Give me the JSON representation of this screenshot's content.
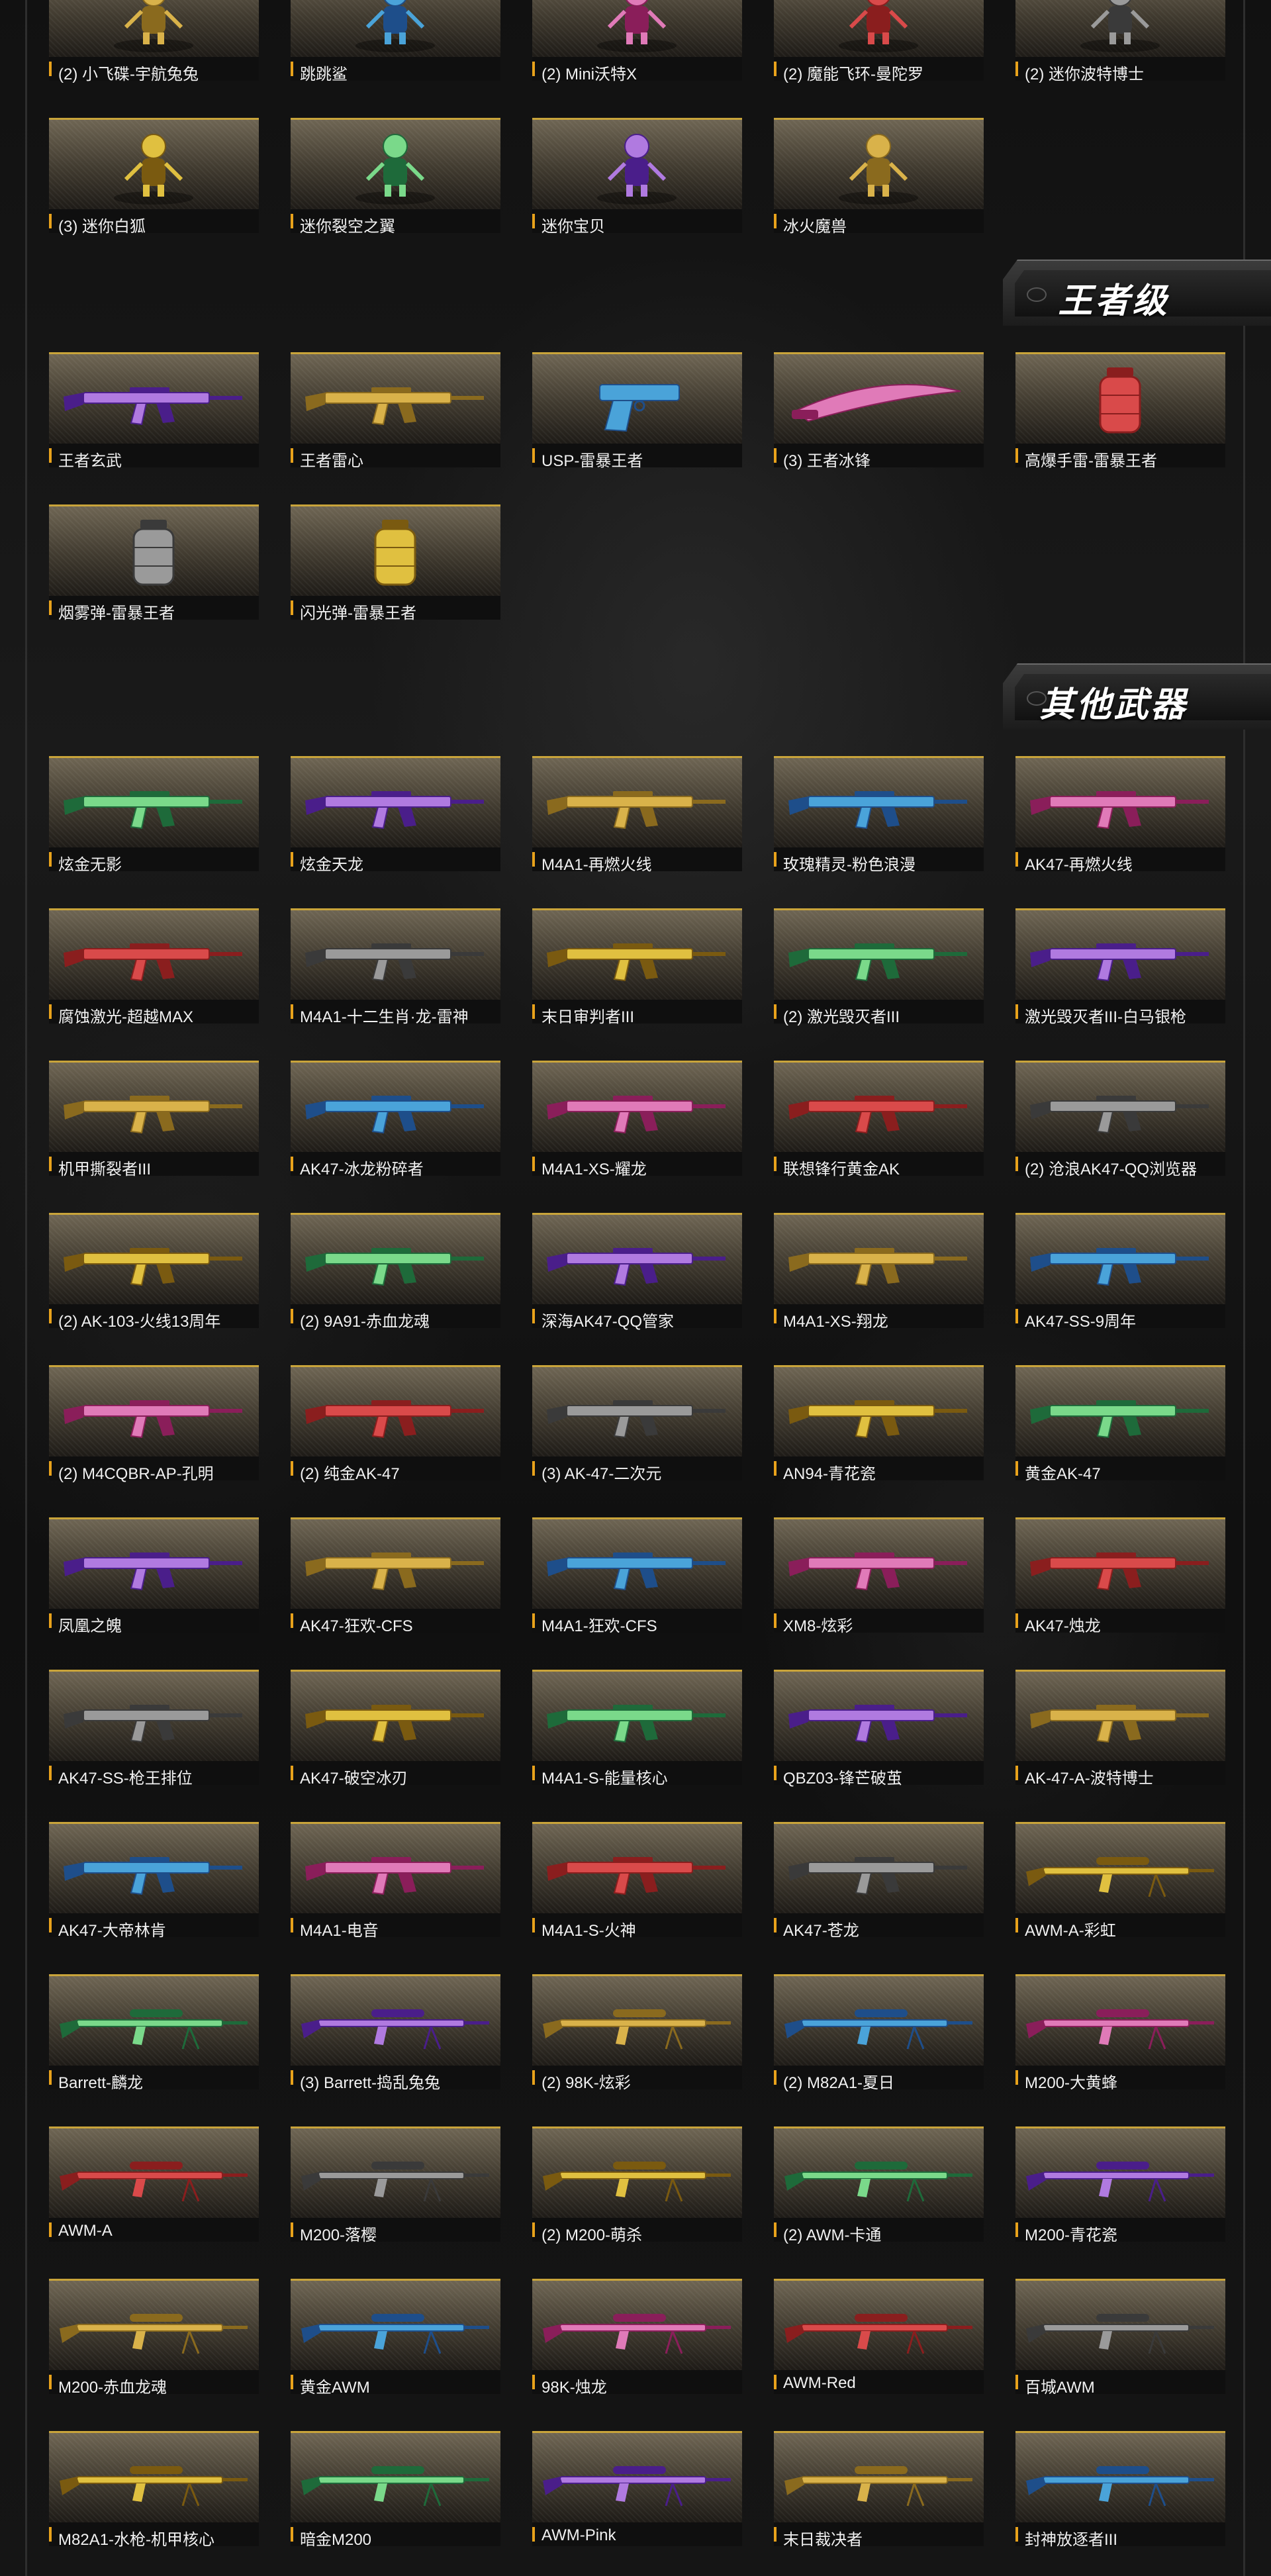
{
  "sections": [
    {
      "title": "",
      "items": [
        {
          "name": "(2) 小飞碟-宇航兔兔",
          "kind": "character"
        },
        {
          "name": "跳跳鲨",
          "kind": "character"
        },
        {
          "name": "(2) Mini沃特X",
          "kind": "character"
        },
        {
          "name": "(2) 魔能飞环-曼陀罗",
          "kind": "character"
        },
        {
          "name": "(2) 迷你波特博士",
          "kind": "character"
        },
        {
          "name": "(3) 迷你白狐",
          "kind": "character"
        },
        {
          "name": "迷你裂空之翼",
          "kind": "character"
        },
        {
          "name": "迷你宝贝",
          "kind": "character"
        },
        {
          "name": "冰火魔兽",
          "kind": "character"
        }
      ]
    },
    {
      "title": "王者级",
      "items": [
        {
          "name": "王者玄武",
          "kind": "rifle"
        },
        {
          "name": "王者雷心",
          "kind": "rifle"
        },
        {
          "name": "USP-雷暴王者",
          "kind": "pistol"
        },
        {
          "name": "(3) 王者冰锋",
          "kind": "blade"
        },
        {
          "name": "高爆手雷-雷暴王者",
          "kind": "grenade"
        },
        {
          "name": "烟雾弹-雷暴王者",
          "kind": "grenade"
        },
        {
          "name": "闪光弹-雷暴王者",
          "kind": "grenade"
        }
      ]
    },
    {
      "title": "其他武器",
      "items": [
        {
          "name": "炫金无影",
          "kind": "rifle"
        },
        {
          "name": "炫金天龙",
          "kind": "rifle"
        },
        {
          "name": "M4A1-再燃火线",
          "kind": "rifle"
        },
        {
          "name": "玫瑰精灵-粉色浪漫",
          "kind": "rifle"
        },
        {
          "name": "AK47-再燃火线",
          "kind": "rifle"
        },
        {
          "name": "腐蚀激光-超越MAX",
          "kind": "rifle"
        },
        {
          "name": "M4A1-十二生肖·龙-雷神",
          "kind": "rifle"
        },
        {
          "name": "末日审判者III",
          "kind": "rifle"
        },
        {
          "name": "(2) 激光毁灭者III",
          "kind": "rifle"
        },
        {
          "name": "激光毁灭者III-白马银枪",
          "kind": "rifle"
        },
        {
          "name": "机甲撕裂者III",
          "kind": "rifle"
        },
        {
          "name": "AK47-冰龙粉碎者",
          "kind": "rifle"
        },
        {
          "name": "M4A1-XS-耀龙",
          "kind": "rifle"
        },
        {
          "name": "联想锋行黄金AK",
          "kind": "rifle"
        },
        {
          "name": "(2) 沧浪AK47-QQ浏览器",
          "kind": "rifle"
        },
        {
          "name": "(2) AK-103-火线13周年",
          "kind": "rifle"
        },
        {
          "name": "(2) 9A91-赤血龙魂",
          "kind": "rifle"
        },
        {
          "name": "深海AK47-QQ管家",
          "kind": "rifle"
        },
        {
          "name": "M4A1-XS-翔龙",
          "kind": "rifle"
        },
        {
          "name": "AK47-SS-9周年",
          "kind": "rifle"
        },
        {
          "name": "(2) M4CQBR-AP-孔明",
          "kind": "rifle"
        },
        {
          "name": "(2) 纯金AK-47",
          "kind": "rifle"
        },
        {
          "name": "(3) AK-47-二次元",
          "kind": "rifle"
        },
        {
          "name": "AN94-青花瓷",
          "kind": "rifle"
        },
        {
          "name": "黄金AK-47",
          "kind": "rifle"
        },
        {
          "name": "凤凰之魄",
          "kind": "rifle"
        },
        {
          "name": "AK47-狂欢-CFS",
          "kind": "rifle"
        },
        {
          "name": "M4A1-狂欢-CFS",
          "kind": "rifle"
        },
        {
          "name": "XM8-炫彩",
          "kind": "rifle"
        },
        {
          "name": "AK47-烛龙",
          "kind": "rifle"
        },
        {
          "name": "AK47-SS-枪王排位",
          "kind": "rifle"
        },
        {
          "name": "AK47-破空冰刃",
          "kind": "rifle"
        },
        {
          "name": "M4A1-S-能量核心",
          "kind": "rifle"
        },
        {
          "name": "QBZ03-锋芒破茧",
          "kind": "rifle"
        },
        {
          "name": "AK-47-A-波特博士",
          "kind": "rifle"
        },
        {
          "name": "AK47-大帝林肯",
          "kind": "rifle"
        },
        {
          "name": "M4A1-电音",
          "kind": "rifle"
        },
        {
          "name": "M4A1-S-火神",
          "kind": "rifle"
        },
        {
          "name": "AK47-苍龙",
          "kind": "rifle"
        },
        {
          "name": "AWM-A-彩虹",
          "kind": "sniper"
        },
        {
          "name": "Barrett-麟龙",
          "kind": "sniper"
        },
        {
          "name": "(3) Barrett-捣乱兔兔",
          "kind": "sniper"
        },
        {
          "name": "(2) 98K-炫彩",
          "kind": "sniper"
        },
        {
          "name": "(2) M82A1-夏日",
          "kind": "sniper"
        },
        {
          "name": "M200-大黄蜂",
          "kind": "sniper"
        },
        {
          "name": "AWM-A",
          "kind": "sniper"
        },
        {
          "name": "M200-落樱",
          "kind": "sniper"
        },
        {
          "name": "(2) M200-萌杀",
          "kind": "sniper"
        },
        {
          "name": "(2) AWM-卡通",
          "kind": "sniper"
        },
        {
          "name": "M200-青花瓷",
          "kind": "sniper"
        },
        {
          "name": "M200-赤血龙魂",
          "kind": "sniper"
        },
        {
          "name": "黄金AWM",
          "kind": "sniper"
        },
        {
          "name": "98K-烛龙",
          "kind": "sniper"
        },
        {
          "name": "AWM-Red",
          "kind": "sniper"
        },
        {
          "name": "百城AWM",
          "kind": "sniper"
        },
        {
          "name": "M82A1-水枪-机甲核心",
          "kind": "sniper"
        },
        {
          "name": "暗金M200",
          "kind": "sniper"
        },
        {
          "name": "AWM-Pink",
          "kind": "sniper"
        },
        {
          "name": "末日裁决者",
          "kind": "sniper"
        },
        {
          "name": "封神放逐者III",
          "kind": "sniper"
        }
      ]
    }
  ],
  "colors": {
    "accent_bar": "#e8a21b",
    "card_top_border": "#c9a43a",
    "caption_text": "#f1f1f1",
    "page_background": "#0d0d0d"
  }
}
